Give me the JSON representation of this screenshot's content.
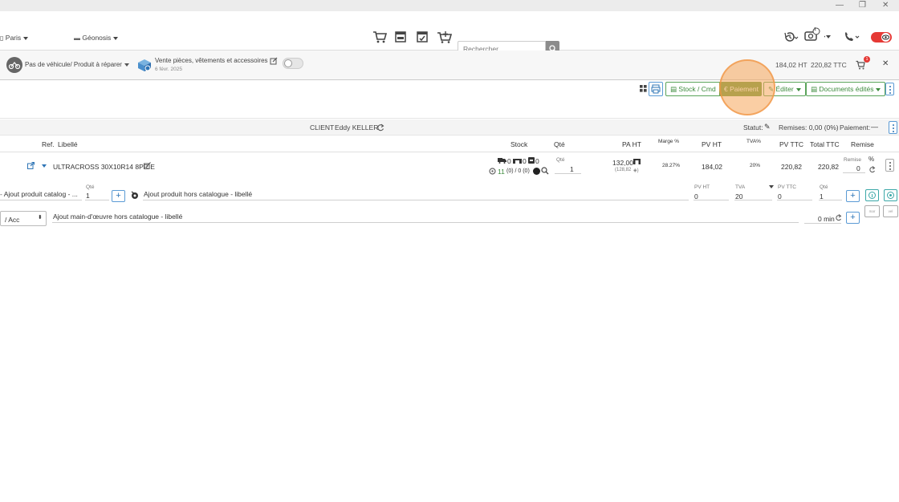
{
  "navbar": {
    "location": "Paris",
    "site": "Géonosis",
    "search_placeholder": "Rechercher",
    "notification_count": "1"
  },
  "infobar": {
    "vehicle_label": "Pas de véhicule/ Produit à réparer",
    "sale_type": "Vente pièces, vêtements et accessoires",
    "date": "6 févr. 2025",
    "total_ht": "184,02 HT",
    "total_ttc": "220,82 TTC",
    "cart_badge": "1"
  },
  "toolbar": {
    "stock_cmd": "Stock / Cmd",
    "payment": "€ Paiement",
    "edit": "Éditer",
    "documents": "Documents édités"
  },
  "clientbar": {
    "client_label": "CLIENT",
    "client_name": "Eddy KELLER",
    "status_label": "Statut:",
    "discounts": "Remises: 0,00 (0%)",
    "payment_label": "Paiement:",
    "payment_value": "—"
  },
  "table": {
    "headers": {
      "ref": "Ref.",
      "libelle": "Libellé",
      "stock": "Stock",
      "qte": "Qté",
      "pa_ht": "PA HT",
      "marge": "Marge %",
      "pv_ht": "PV HT",
      "tva": "TVA%",
      "pv_ttc": "PV TTC",
      "total_ttc": "Total TTC",
      "remise": "Remise"
    },
    "row": {
      "libelle": "ULTRACROSS 30X10R14 8PR E",
      "stock_a": "0",
      "stock_b": "0",
      "stock_c": "0",
      "stock_d": "11",
      "stock_e": "(0) / 0 (0)",
      "qte_label": "Qté",
      "qte": "1",
      "pa_ht": "132,00",
      "pa_ht_sub": "(128,82",
      "marge": "28.27%",
      "pv_ht": "184,02",
      "tva": "20%",
      "pv_ttc": "220,82",
      "total_ttc": "220,82",
      "remise_label": "Remise",
      "remise": "0",
      "percent": "%"
    }
  },
  "add_catalog": {
    "label": "Ajout produit catalog - ...",
    "qte_label": "Qté",
    "qte": "1",
    "hors_label": "Ajout produit hors catalogue - libellé",
    "pv_ht_label": "PV HT",
    "pv_ht": "0",
    "tva_label": "TVA",
    "tva": "20",
    "pv_ttc_label": "PV TTC",
    "pv_ttc": "0",
    "qte2_label": "Qté",
    "qte2": "1"
  },
  "add_labor": {
    "select": "/ Acc",
    "label": "Ajout main-d'œuvre hors catalogue - libellé",
    "duration": "0 min",
    "btn_a": "mar",
    "btn_b": "vel"
  }
}
